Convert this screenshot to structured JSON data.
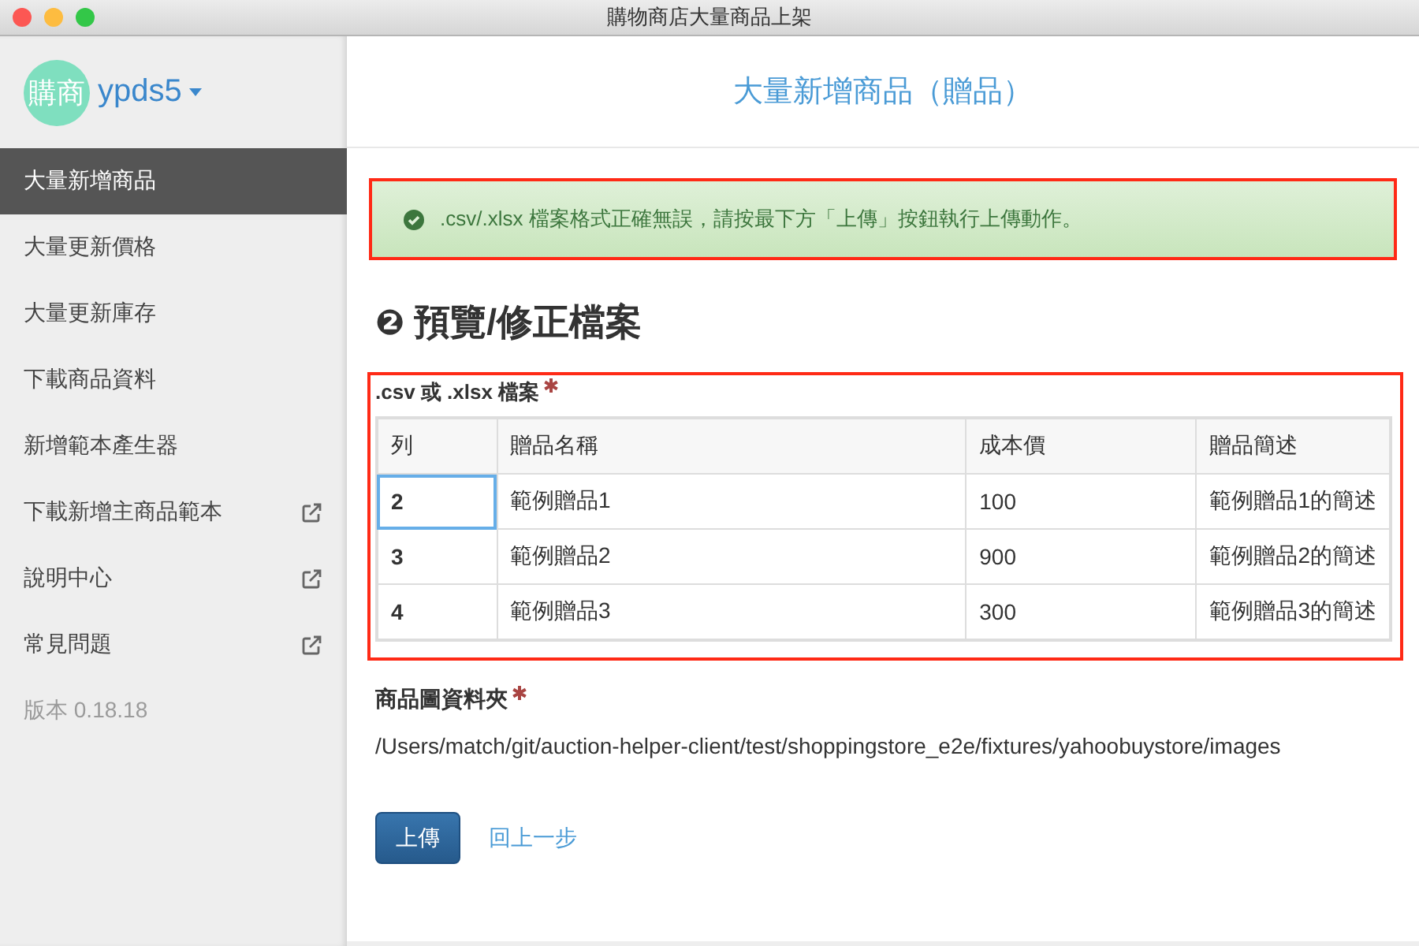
{
  "window": {
    "title": "購物商店大量商品上架"
  },
  "profile": {
    "avatar_text": "購商",
    "username": "ypds5"
  },
  "sidebar": {
    "items": [
      {
        "label": "大量新增商品",
        "selected": true,
        "external": false
      },
      {
        "label": "大量更新價格",
        "selected": false,
        "external": false
      },
      {
        "label": "大量更新庫存",
        "selected": false,
        "external": false
      },
      {
        "label": "下載商品資料",
        "selected": false,
        "external": false
      },
      {
        "label": "新增範本產生器",
        "selected": false,
        "external": false
      },
      {
        "label": "下載新增主商品範本",
        "selected": false,
        "external": true
      },
      {
        "label": "說明中心",
        "selected": false,
        "external": true
      },
      {
        "label": "常見問題",
        "selected": false,
        "external": true
      }
    ],
    "version": "版本 0.18.18"
  },
  "page_title": "大量新增商品（贈品）",
  "alert": {
    "message": ".csv/.xlsx 檔案格式正確無誤，請按最下方「上傳」按鈕執行上傳動作。"
  },
  "section": {
    "step": "❷",
    "title": "預覽/修正檔案"
  },
  "file_field": {
    "label": ".csv 或 .xlsx 檔案",
    "required": true
  },
  "table": {
    "columns": [
      "列",
      "贈品名稱",
      "成本價",
      "贈品簡述"
    ],
    "rows": [
      {
        "cells": [
          {
            "text": "2",
            "selected": true
          },
          {
            "text": "範例贈品1",
            "selected": false
          },
          {
            "text": "100",
            "selected": false
          },
          {
            "text": "範例贈品1的簡述",
            "selected": false
          }
        ]
      },
      {
        "cells": [
          {
            "text": "3",
            "selected": false
          },
          {
            "text": "範例贈品2",
            "selected": false
          },
          {
            "text": "900",
            "selected": false
          },
          {
            "text": "範例贈品2的簡述",
            "selected": false
          }
        ]
      },
      {
        "cells": [
          {
            "text": "4",
            "selected": false
          },
          {
            "text": "範例贈品3",
            "selected": false
          },
          {
            "text": "300",
            "selected": false
          },
          {
            "text": "範例贈品3的簡述",
            "selected": false
          }
        ]
      }
    ]
  },
  "folder_field": {
    "label": "商品圖資料夾",
    "required": true,
    "value": "/Users/match/git/auction-helper-client/test/shoppingstore_e2e/fixtures/yahoobuystore/images"
  },
  "buttons": {
    "upload": "上傳",
    "back": "回上一步"
  }
}
